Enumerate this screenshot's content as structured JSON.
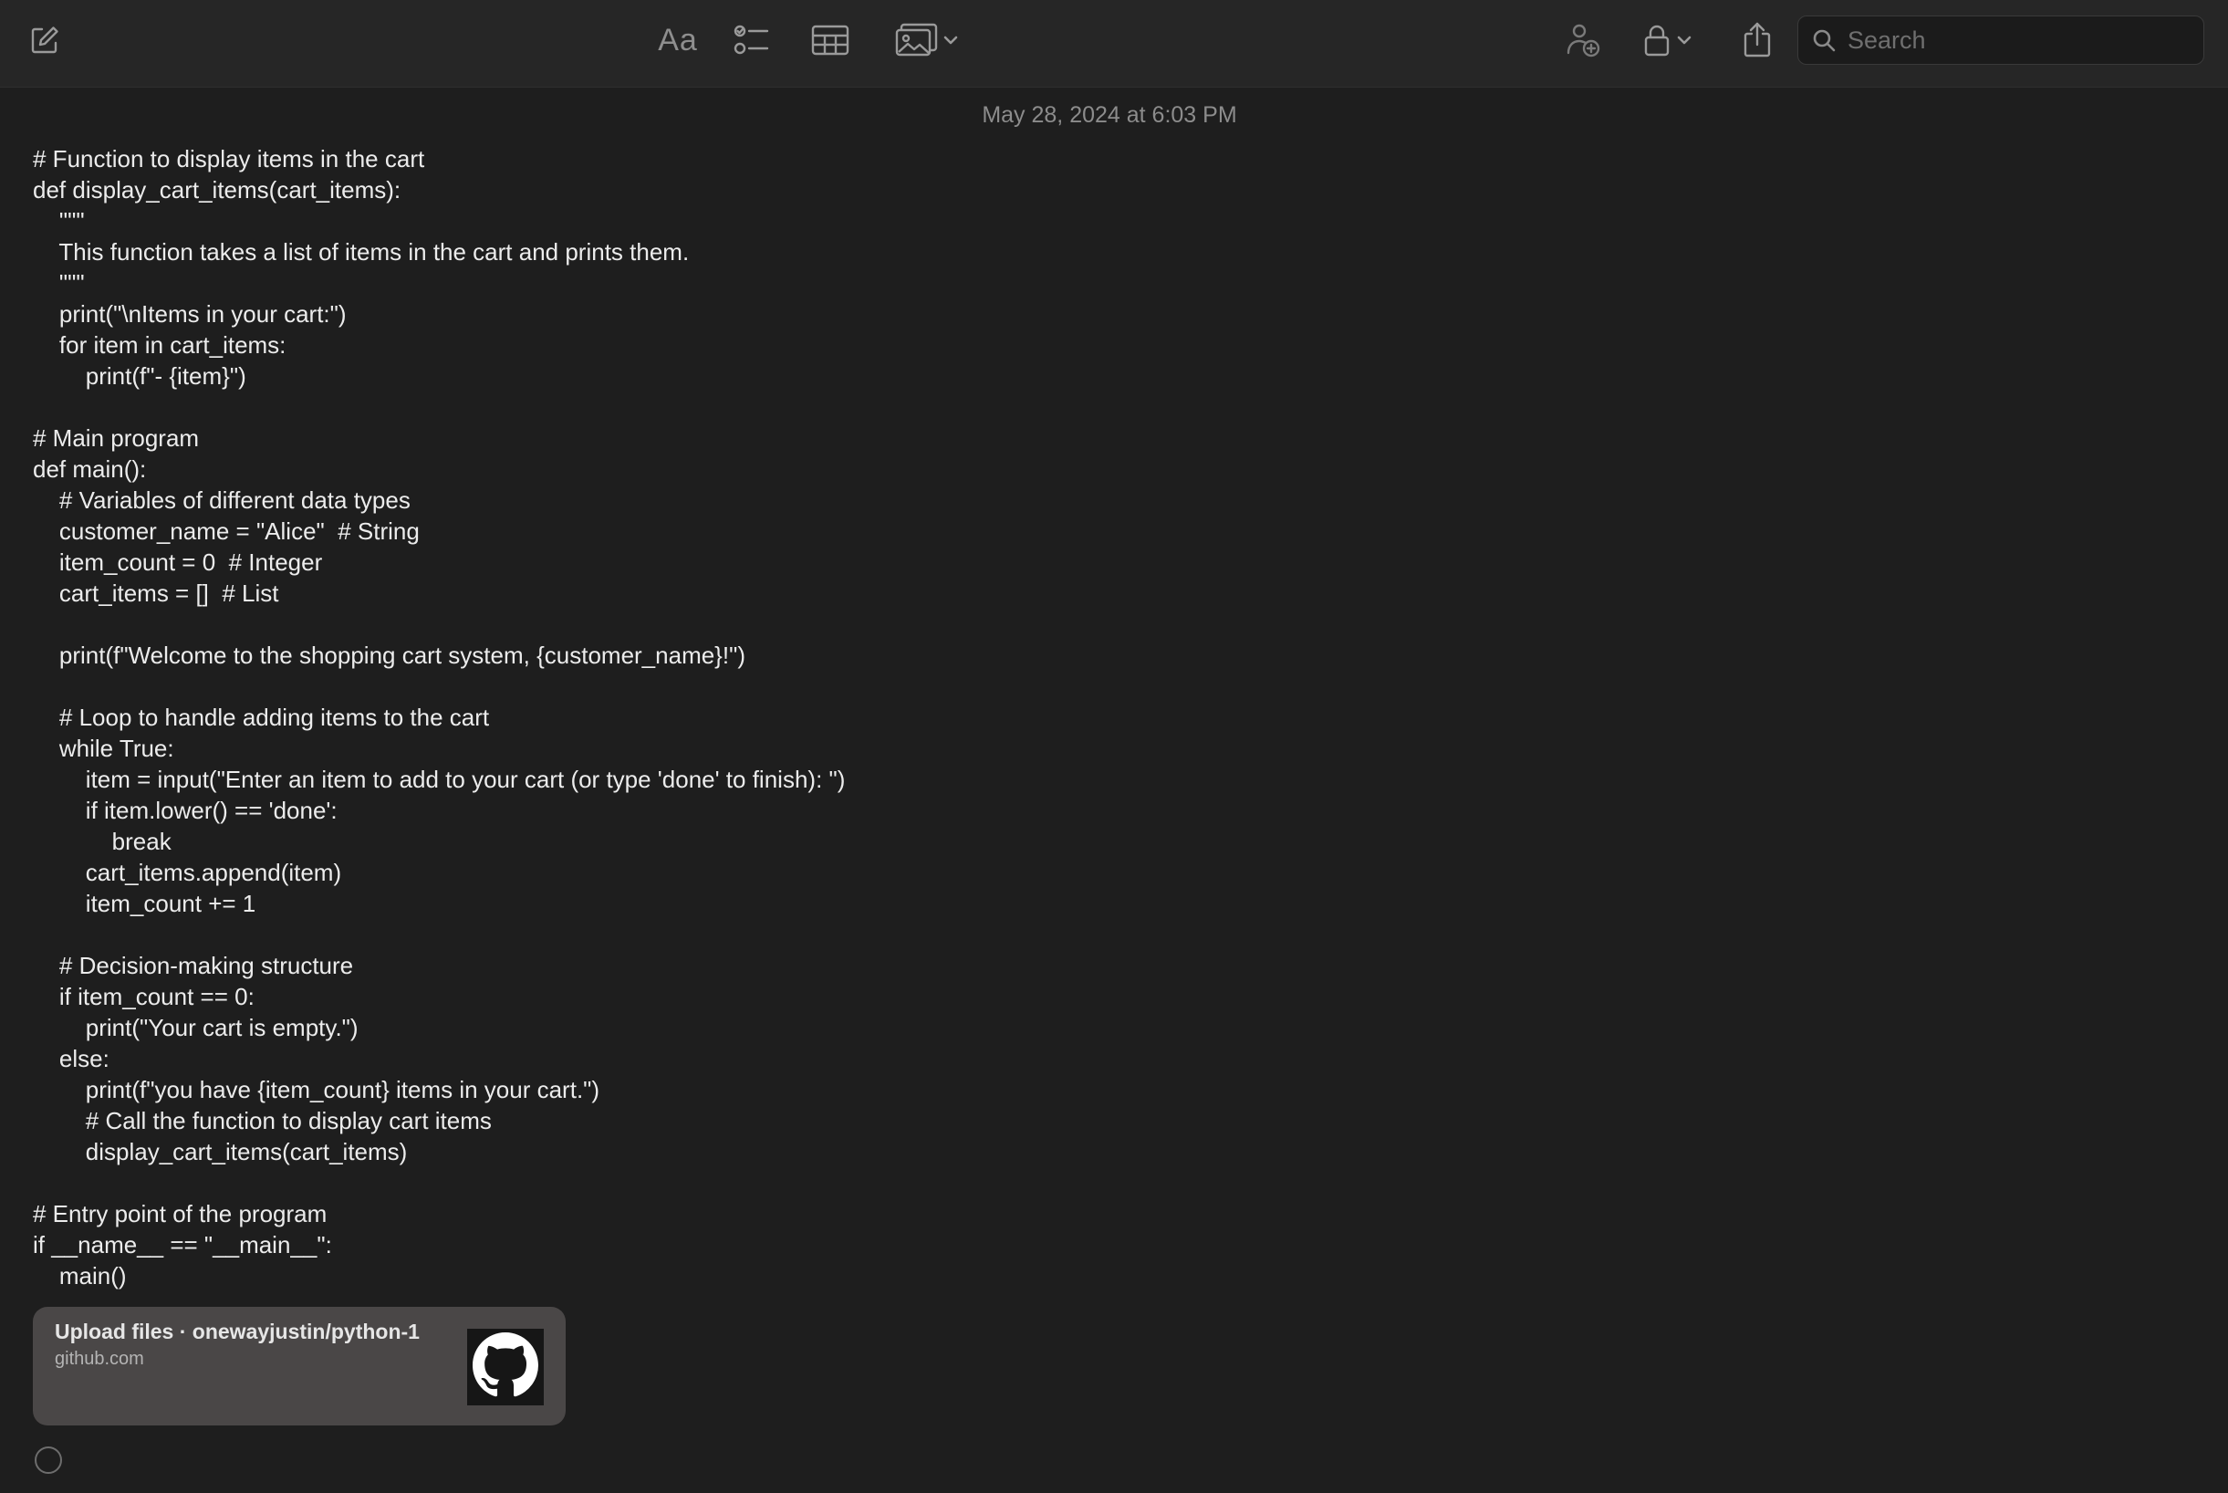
{
  "toolbar": {
    "compose_icon": "compose-icon",
    "format_label": "Aa",
    "checklist_icon": "checklist-icon",
    "table_icon": "table-icon",
    "media_icon": "photo-icon",
    "collaborate_icon": "collaborate-icon",
    "lock_icon": "lock-icon",
    "share_icon": "share-icon",
    "search_placeholder": "Search"
  },
  "note": {
    "timestamp": "May 28, 2024 at 6:03 PM",
    "lines": [
      "# Function to display items in the cart",
      "def display_cart_items(cart_items):",
      "    \"\"\"",
      "    This function takes a list of items in the cart and prints them.",
      "    \"\"\"",
      "    print(\"\\nItems in your cart:\")",
      "    for item in cart_items:",
      "        print(f\"- {item}\")",
      "",
      "# Main program",
      "def main():",
      "    # Variables of different data types",
      "    customer_name = \"Alice\"  # String",
      "    item_count = 0  # Integer",
      "    cart_items = []  # List",
      "",
      "    print(f\"Welcome to the shopping cart system, {customer_name}!\")",
      "",
      "    # Loop to handle adding items to the cart",
      "    while True:",
      "        item = input(\"Enter an item to add to your cart (or type 'done' to finish): \")",
      "        if item.lower() == 'done':",
      "            break",
      "        cart_items.append(item)",
      "        item_count += 1",
      "",
      "    # Decision-making structure",
      "    if item_count == 0:",
      "        print(\"Your cart is empty.\")",
      "    else:",
      "        print(f\"you have {item_count} items in your cart.\")",
      "        # Call the function to display cart items",
      "        display_cart_items(cart_items)",
      "",
      "# Entry point of the program",
      "if __name__ == \"__main__\":",
      "    main()"
    ]
  },
  "link_card": {
    "title": "Upload files · onewayjustin/python-1",
    "domain": "github.com",
    "thumbnail_icon": "github-icon"
  },
  "checklist_item_icon": "empty-checkbox-icon"
}
